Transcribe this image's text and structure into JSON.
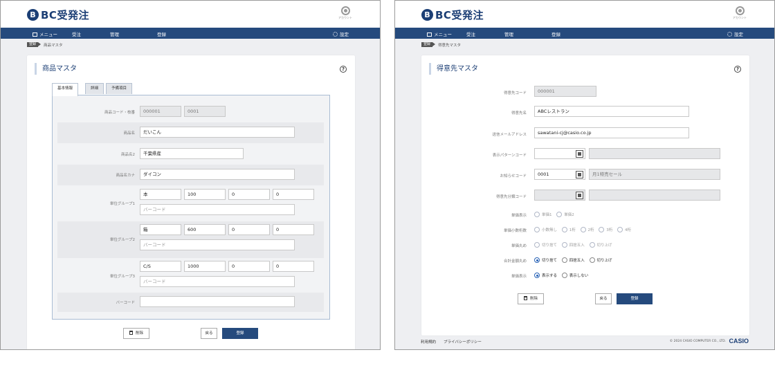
{
  "app": {
    "logo_mark": "B",
    "logo_text": "BC受発注",
    "account_label": "アカウント"
  },
  "nav": {
    "menu": "メニュー",
    "order": "受注",
    "manage": "管理",
    "register": "登録",
    "settings": "設定"
  },
  "crumb_tag": "登録",
  "left": {
    "breadcrumb": "商品マスタ",
    "title": "商品マスタ",
    "help": "?",
    "tabs": [
      "基本情報",
      "詳細",
      "予備項目"
    ],
    "fields": {
      "code_label": "商品コード・枝番",
      "code": "000001",
      "branch": "0001",
      "name_label": "商品名",
      "name": "だいこん",
      "name2_label": "商品名2",
      "name2": "千葉県産",
      "kana_label": "商品名カナ",
      "kana": "ダイコン",
      "barcode_placeholder": "バーコード",
      "groups": [
        {
          "label": "単位グループ1",
          "unit": "本",
          "v1": "100",
          "v2": "0",
          "v3": "0"
        },
        {
          "label": "単位グループ2",
          "unit": "箱",
          "v1": "600",
          "v2": "0",
          "v3": "0"
        },
        {
          "label": "単位グループ3",
          "unit": "C/S",
          "v1": "1000",
          "v2": "0",
          "v3": "0"
        }
      ],
      "barcode_label": "バーコード",
      "barcode": ""
    },
    "buttons": {
      "delete": "削除",
      "back": "戻る",
      "save": "登録"
    }
  },
  "right": {
    "breadcrumb": "得意先マスタ",
    "title": "得意先マスタ",
    "help": "?",
    "fields": {
      "code_label": "得意先コード",
      "code": "000001",
      "name_label": "得意先名",
      "name": "ABCレストラン",
      "email_label": "送信メールアドレス",
      "email": "sawatani-cj@casio.co.jp",
      "pattern_label": "表示パターンコード",
      "pattern_code": "",
      "pattern_name": "",
      "notice_label": "お知らせコード",
      "notice_code": "0001",
      "notice_name": "月1特売セール",
      "category_label": "得意先分類コード",
      "category_code": "",
      "category_name": ""
    },
    "radios": {
      "price_display": {
        "label": "単価表示",
        "options": [
          "単価1",
          "単価2"
        ]
      },
      "price_decimals": {
        "label": "単価小数桁数",
        "options": [
          "小数無し",
          "1桁",
          "2桁",
          "3桁",
          "4桁"
        ]
      },
      "price_rounding": {
        "label": "単価丸め",
        "options": [
          "切り捨て",
          "四捨五入",
          "切り上げ"
        ]
      },
      "total_rounding": {
        "label": "合計金額丸め",
        "options": [
          "切り捨て",
          "四捨五入",
          "切り上げ"
        ]
      },
      "price_visibility": {
        "label": "単価表示",
        "options": [
          "表示する",
          "表示しない"
        ]
      }
    },
    "buttons": {
      "delete": "削除",
      "back": "戻る",
      "save": "登録"
    },
    "footer": {
      "terms": "利用規約",
      "privacy": "プライバシーポリシー",
      "copyright": "© 2024 CASIO COMPUTER CO., LTD.",
      "brand": "CASIO"
    }
  }
}
